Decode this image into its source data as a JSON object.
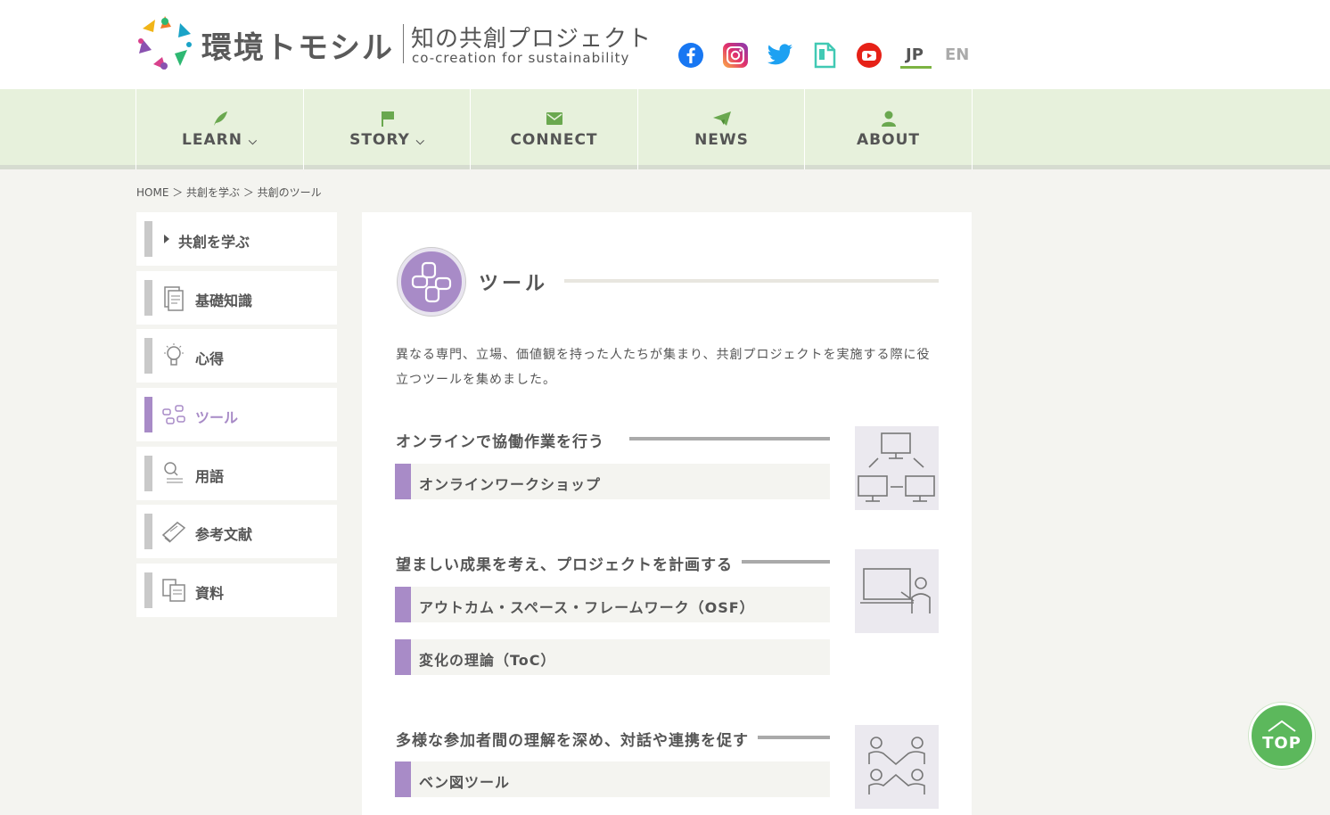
{
  "header": {
    "logo_name": "環境トモシル",
    "logo_subtitle": "知の共創プロジェクト",
    "logo_tagline": "co-creation for sustainability",
    "social": [
      "facebook-icon",
      "instagram-icon",
      "twitter-icon",
      "note-icon",
      "youtube-icon"
    ],
    "languages": [
      {
        "label": "JP",
        "active": true
      },
      {
        "label": "EN",
        "active": false
      }
    ]
  },
  "nav": {
    "items": [
      {
        "label": "LEARN",
        "icon": "leaf-icon",
        "dropdown": true
      },
      {
        "label": "STORY",
        "icon": "flag-icon",
        "dropdown": true
      },
      {
        "label": "CONNECT",
        "icon": "mail-icon",
        "dropdown": false
      },
      {
        "label": "NEWS",
        "icon": "paper-plane-icon",
        "dropdown": false
      },
      {
        "label": "ABOUT",
        "icon": "person-icon",
        "dropdown": false
      }
    ]
  },
  "breadcrumb": "HOME ＞ 共創を学ぶ ＞ 共創のツール",
  "sidebar": {
    "items": [
      {
        "label": "共創を学ぶ"
      },
      {
        "label": "基礎知識"
      },
      {
        "label": "心得"
      },
      {
        "label": "ツール"
      },
      {
        "label": "用語"
      },
      {
        "label": "参考文献"
      },
      {
        "label": "資料"
      }
    ]
  },
  "main": {
    "title": "ツール",
    "intro": "異なる専門、立場、価値観を持った人たちが集まり、共創プロジェクトを実施する際に役立つツールを集めました。",
    "sections": [
      {
        "heading": "オンラインで協働作業を行う",
        "links": [
          "オンラインワークショップ"
        ]
      },
      {
        "heading": "望ましい成果を考え、プロジェクトを計画する",
        "links": [
          "アウトカム・スペース・フレームワーク（OSF）",
          "変化の理論（ToC）"
        ]
      },
      {
        "heading": "多様な参加者間の理解を深め、対話や連携を促す",
        "links": [
          "ベン図ツール"
        ]
      }
    ]
  },
  "top_button": {
    "label": "TOP"
  },
  "colors": {
    "accent_green": "#7cb342",
    "nav_bg": "#e7f1dc",
    "tool_purple": "#a88bc7",
    "top_green": "#5cb85c"
  }
}
